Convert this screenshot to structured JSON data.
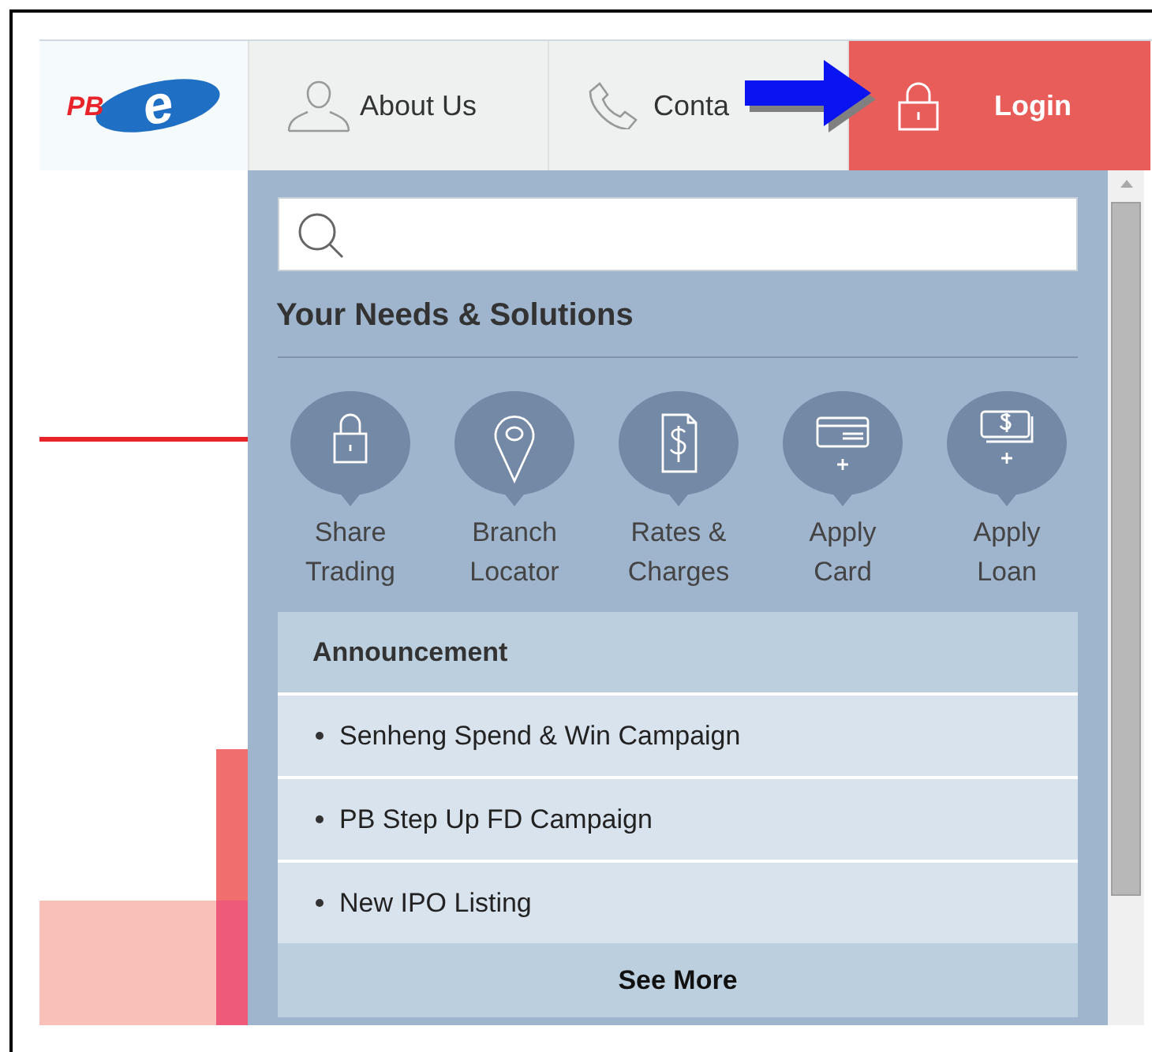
{
  "logo": {
    "letters": "PB",
    "mark": "e"
  },
  "nav": [
    {
      "kind": "person",
      "label": "About Us",
      "primary": false
    },
    {
      "kind": "phone",
      "label": "Conta",
      "primary": false
    },
    {
      "kind": "lock",
      "label": "Login",
      "primary": true
    }
  ],
  "solutions": {
    "title": "Your Needs & Solutions",
    "items": [
      {
        "kind": "lock",
        "label": "Share Trading"
      },
      {
        "kind": "pin",
        "label": "Branch Locator"
      },
      {
        "kind": "rates",
        "label": "Rates & Charges"
      },
      {
        "kind": "card",
        "label": "Apply Card"
      },
      {
        "kind": "loan",
        "label": "Apply Loan"
      }
    ]
  },
  "announcement": {
    "title": "Announcement",
    "items": [
      "Senheng Spend & Win Campaign",
      "PB Step Up FD Campaign",
      "New IPO Listing"
    ],
    "more": "See More"
  }
}
